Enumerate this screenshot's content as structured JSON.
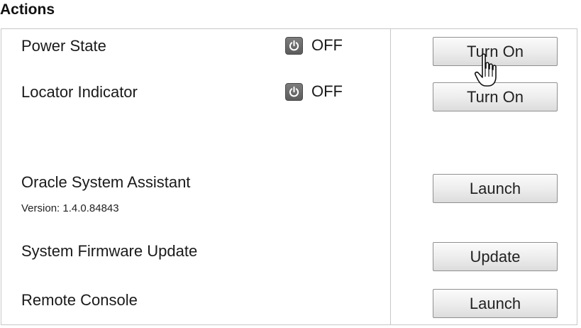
{
  "section": {
    "title": "Actions"
  },
  "rows": [
    {
      "label": "Power State",
      "state_text": "OFF",
      "button": "Turn On",
      "icon": "power-icon"
    },
    {
      "label": "Locator Indicator",
      "state_text": "OFF",
      "button": "Turn On",
      "icon": "power-icon"
    },
    {
      "label": "Oracle System Assistant",
      "sublabel": "Version: 1.4.0.84843",
      "button": "Launch"
    },
    {
      "label": "System Firmware Update",
      "button": "Update"
    },
    {
      "label": "Remote Console",
      "button": "Launch"
    }
  ],
  "cursor": {
    "icon": "hand-pointer-icon"
  }
}
